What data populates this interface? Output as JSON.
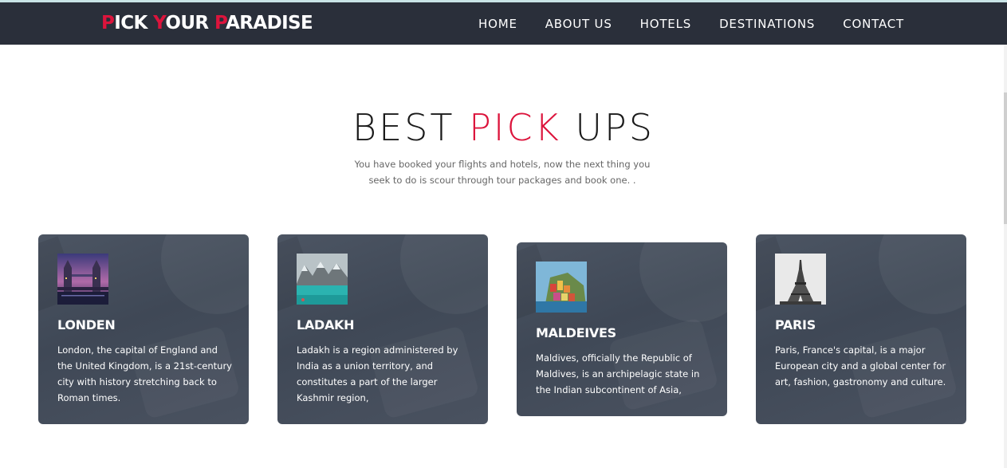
{
  "brand": {
    "logo_parts": [
      {
        "text": "P",
        "accent": true
      },
      {
        "text": "ICK ",
        "accent": false
      },
      {
        "text": "Y",
        "accent": true
      },
      {
        "text": "OUR ",
        "accent": false
      },
      {
        "text": "P",
        "accent": true
      },
      {
        "text": "ARADISE",
        "accent": false
      }
    ]
  },
  "nav": {
    "items": [
      {
        "label": "HOME"
      },
      {
        "label": "ABOUT US"
      },
      {
        "label": "HOTELS"
      },
      {
        "label": "DESTINATIONS"
      },
      {
        "label": "CONTACT"
      }
    ]
  },
  "section": {
    "heading_pre": "BEST ",
    "heading_accent": "PICK",
    "heading_post": " UPS",
    "subtitle": "You have booked your flights and hotels, now the next thing you seek to do is scour through tour packages and book one. ."
  },
  "cards": [
    {
      "title": "LONDEN",
      "image": "london-tower-bridge-image",
      "description": "London, the capital of England and the United Kingdom, is a 21st-century city with history stretching back to Roman times."
    },
    {
      "title": "LADAKH",
      "image": "ladakh-lake-mountains-image",
      "description": "Ladakh is a region administered by India as a union territory, and constitutes a part of the larger Kashmir region,"
    },
    {
      "title": "MALDEIVES",
      "image": "coastal-village-image",
      "description": "Maldives, officially the Republic of Maldives, is an archipelagic state in the Indian subcontinent of Asia,"
    },
    {
      "title": "PARIS",
      "image": "eiffel-tower-image",
      "description": "Paris, France's capital, is a major European city and a global center for art, fashion, gastronomy and culture."
    }
  ],
  "colors": {
    "accent": "#dc143c",
    "navbar_bg": "#2a2f3a",
    "card_bg": "#454e5c"
  }
}
